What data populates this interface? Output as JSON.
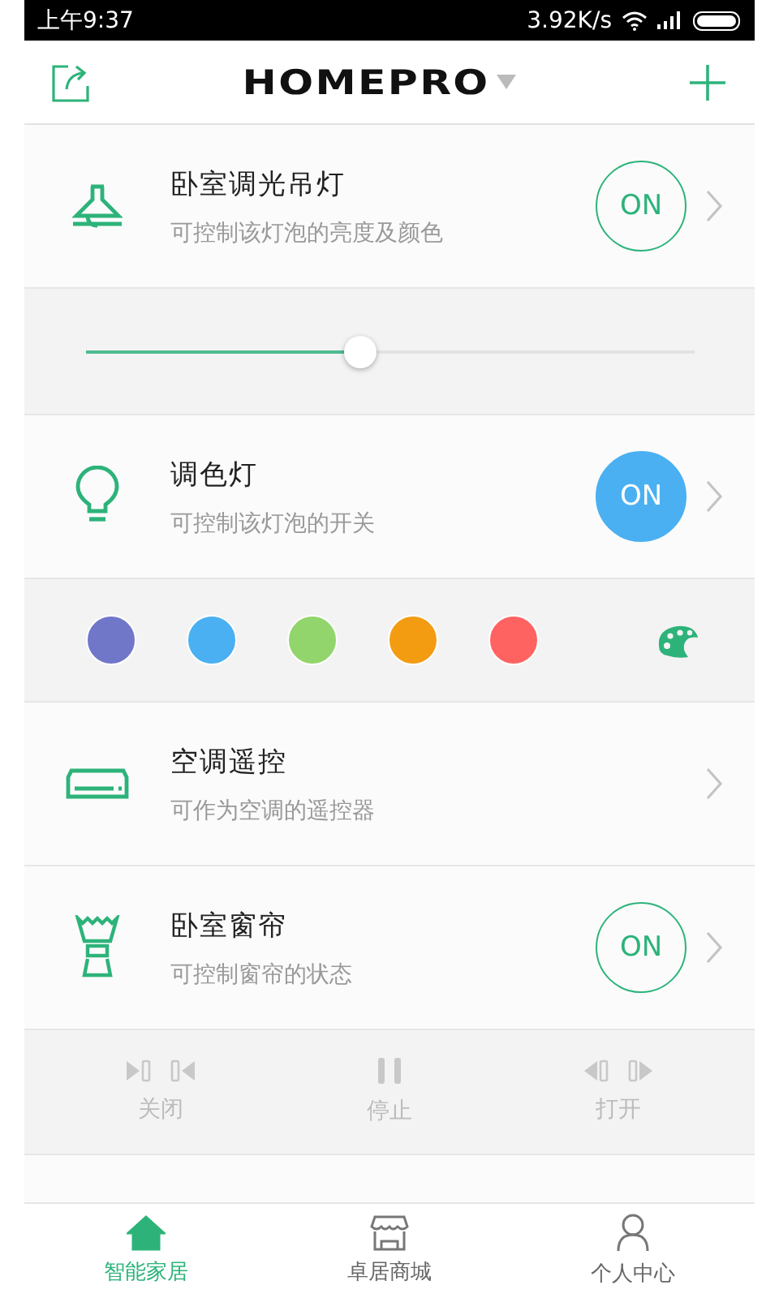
{
  "status_bar": {
    "time": "上午9:37",
    "speed": "3.92K/s"
  },
  "header": {
    "title": "HOMEPRO"
  },
  "devices": [
    {
      "kind": "lamp",
      "name": "卧室调光吊灯",
      "description": "可控制该灯泡的亮度及颜色",
      "toggle": {
        "label": "ON",
        "filled": false
      },
      "panel": {
        "kind": "slider",
        "level": 0.45
      }
    },
    {
      "kind": "bulb",
      "name": "调色灯",
      "description": "可控制该灯泡的开关",
      "toggle": {
        "label": "ON",
        "filled": true
      },
      "panel": {
        "kind": "colors",
        "swatches": [
          {
            "color": "#7077c9"
          },
          {
            "color": "#4ab0f2"
          },
          {
            "color": "#92d56d"
          },
          {
            "color": "#f39c12"
          },
          {
            "color": "#ff6361"
          }
        ]
      }
    },
    {
      "kind": "aircon",
      "name": "空调遥控",
      "description": "可作为空调的遥控器"
    },
    {
      "kind": "curtain",
      "name": "卧室窗帘",
      "description": "可控制窗帘的状态",
      "toggle": {
        "label": "ON",
        "filled": false
      },
      "panel": {
        "kind": "curtain",
        "actions": [
          {
            "kind": "close",
            "label": "关闭"
          },
          {
            "kind": "stop",
            "label": "停止"
          },
          {
            "kind": "open",
            "label": "打开"
          }
        ]
      }
    }
  ],
  "tabs": [
    {
      "kind": "home",
      "label": "智能家居",
      "selected": true
    },
    {
      "kind": "store",
      "label": "卓居商城",
      "selected": false
    },
    {
      "kind": "person",
      "label": "个人中心",
      "selected": false
    }
  ]
}
